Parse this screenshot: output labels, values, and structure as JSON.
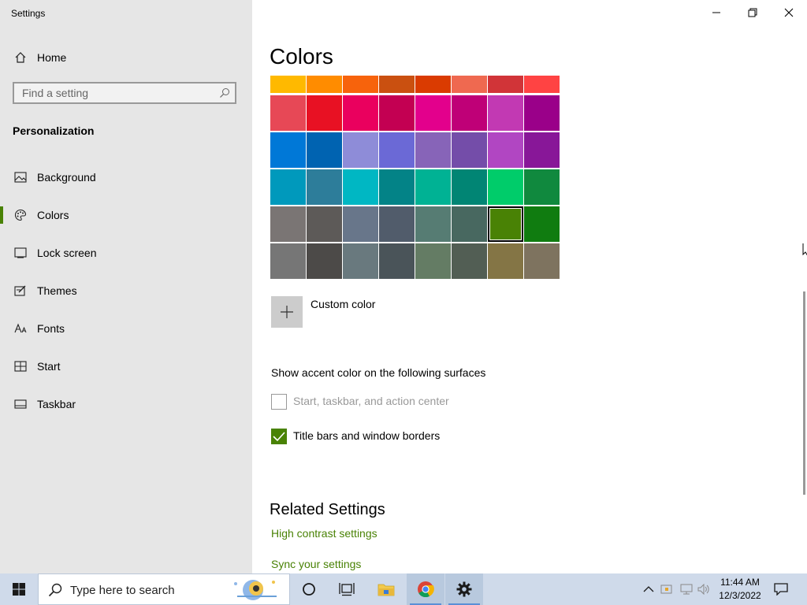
{
  "window": {
    "title": "Settings"
  },
  "sidebar": {
    "home_label": "Home",
    "search_placeholder": "Find a setting",
    "section": "Personalization",
    "items": [
      {
        "label": "Background",
        "icon": "picture-icon"
      },
      {
        "label": "Colors",
        "icon": "palette-icon",
        "active": true
      },
      {
        "label": "Lock screen",
        "icon": "lock-screen-icon"
      },
      {
        "label": "Themes",
        "icon": "themes-icon"
      },
      {
        "label": "Fonts",
        "icon": "fonts-icon"
      },
      {
        "label": "Start",
        "icon": "start-icon"
      },
      {
        "label": "Taskbar",
        "icon": "taskbar-icon"
      }
    ]
  },
  "main": {
    "title": "Colors",
    "accent_palette": [
      [
        "#ffb900",
        "#ff8c00",
        "#f7630c",
        "#ca5010",
        "#da3b01",
        "#ef6950",
        "#d13438",
        "#ff4343"
      ],
      [
        "#e74856",
        "#e81123",
        "#ea005e",
        "#c30052",
        "#e3008c",
        "#bf0077",
        "#c239b3",
        "#9a0089"
      ],
      [
        "#0078d7",
        "#0063b1",
        "#8e8cd8",
        "#6b69d6",
        "#8764b8",
        "#744da9",
        "#b146c2",
        "#881798"
      ],
      [
        "#0099bc",
        "#2d7d9a",
        "#00b7c3",
        "#038387",
        "#00b294",
        "#018574",
        "#00cc6a",
        "#10893e"
      ],
      [
        "#7a7574",
        "#5d5a58",
        "#68768a",
        "#515c6b",
        "#567c73",
        "#486860",
        "#498205",
        "#107c10"
      ],
      [
        "#767676",
        "#4c4a48",
        "#69797e",
        "#4a5459",
        "#647c64",
        "#525e54",
        "#847545",
        "#7e735f"
      ]
    ],
    "selected_color": "#498205",
    "custom_color_label": "Custom color",
    "surfaces_heading": "Show accent color on the following surfaces",
    "checkboxes": [
      {
        "label": "Start, taskbar, and action center",
        "checked": false,
        "disabled": true
      },
      {
        "label": "Title bars and window borders",
        "checked": true,
        "disabled": false
      }
    ],
    "related_heading": "Related Settings",
    "links": [
      "High contrast settings",
      "Sync your settings"
    ]
  },
  "taskbar": {
    "search_placeholder": "Type here to search",
    "time": "11:44 AM",
    "date": "12/3/2022"
  },
  "colors": {
    "accent": "#498205",
    "sidebar_bg": "#e6e6e6",
    "taskbar_bg": "#cfdaea"
  }
}
